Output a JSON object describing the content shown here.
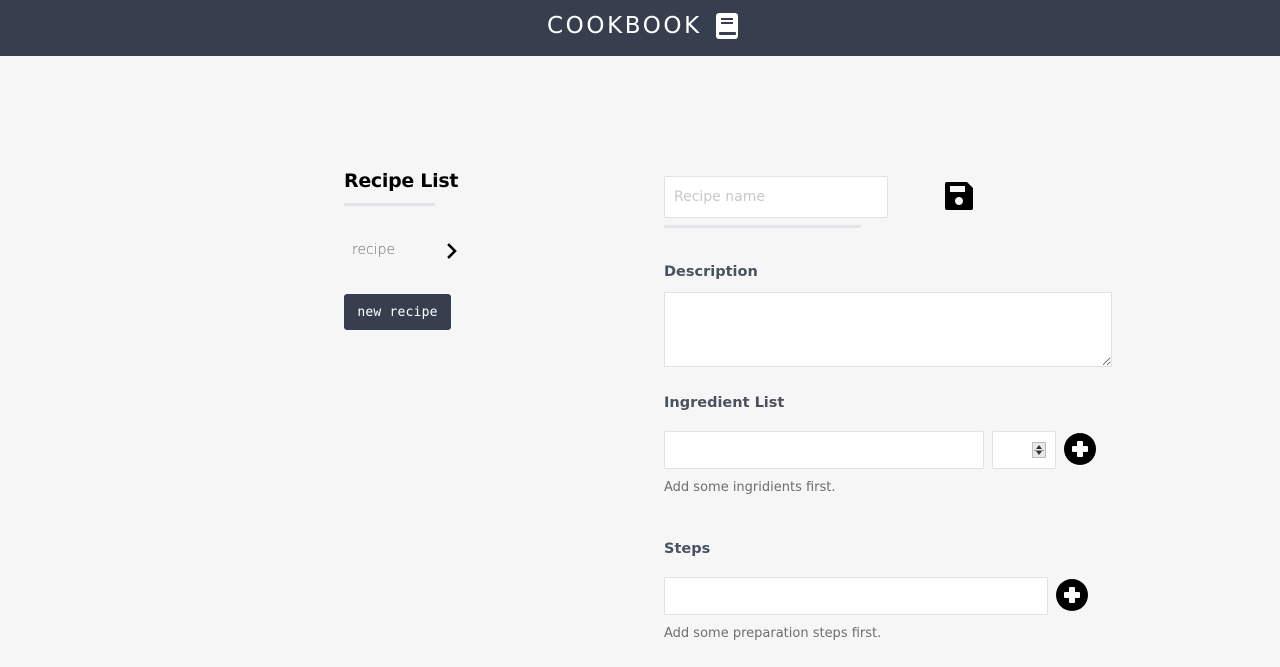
{
  "header": {
    "title": "COOKBOOK",
    "icon": "book-icon"
  },
  "sidebar": {
    "title": "Recipe List",
    "recipes": [
      {
        "label": "recipe",
        "icon": "chevron-right-icon"
      }
    ],
    "new_recipe_label": "new recipe"
  },
  "editor": {
    "name_input": {
      "value": "",
      "placeholder": "Recipe name"
    },
    "save_icon": "floppy-disk-icon",
    "description": {
      "label": "Description",
      "value": ""
    },
    "ingredients": {
      "label": "Ingredient List",
      "name_value": "",
      "quantity_value": "",
      "add_icon": "plus-circle-icon",
      "empty_hint": "Add some ingridients first."
    },
    "steps": {
      "label": "Steps",
      "value": "",
      "add_icon": "plus-circle-icon",
      "empty_hint": "Add some preparation steps first."
    }
  },
  "colors": {
    "header_bg": "#373f4e",
    "page_bg": "#f6f6f6",
    "button_bg": "#373f4e",
    "label_text": "#4a5260"
  }
}
